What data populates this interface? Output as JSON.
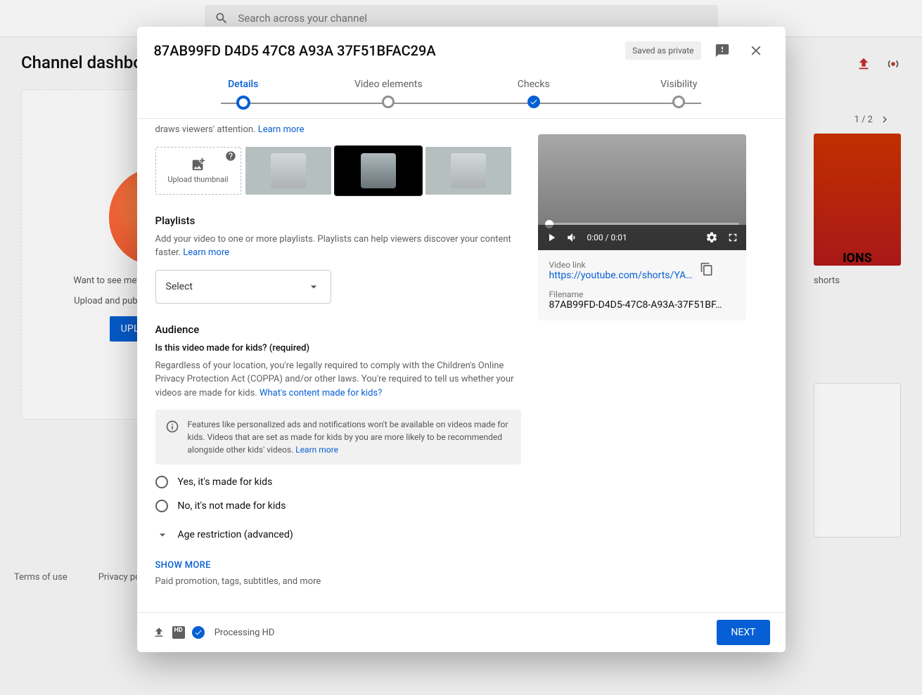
{
  "search": {
    "placeholder": "Search across your channel"
  },
  "page": {
    "title": "Channel dashboard",
    "left_card": {
      "prompt1": "Want to see metrics on your recent video?",
      "prompt2": "Upload and publish a video to get started.",
      "upload_btn": "UPLOAD VIDEOS"
    },
    "pager": "1 / 2",
    "news_thumb_text": "IONS",
    "news_caption": "shorts",
    "footer": {
      "terms": "Terms of use",
      "privacy": "Privacy policy"
    }
  },
  "modal": {
    "title": "87AB99FD D4D5 47C8 A93A 37F51BFAC29A",
    "saved_badge": "Saved as private",
    "steps": {
      "details": "Details",
      "elements": "Video elements",
      "checks": "Checks",
      "visibility": "Visibility"
    },
    "thumbs": {
      "hint_tail": "draws viewers' attention. ",
      "learn": "Learn more",
      "upload_label": "Upload thumbnail"
    },
    "playlists": {
      "heading": "Playlists",
      "sub": "Add your video to one or more playlists. Playlists can help viewers discover your content faster. ",
      "learn": "Learn more",
      "select": "Select"
    },
    "audience": {
      "heading": "Audience",
      "req": "Is this video made for kids? (required)",
      "coppa": "Regardless of your location, you're legally required to comply with the Children's Online Privacy Protection Act (COPPA) and/or other laws. You're required to tell us whether your videos are made for kids. ",
      "coppa_link": "What's content made for kids?",
      "info": "Features like personalized ads and notifications won't be available on videos made for kids. Videos that are set as made for kids by you are more likely to be recommended alongside other kids' videos. ",
      "info_link": "Learn more",
      "yes": "Yes, it's made for kids",
      "no": "No, it's not made for kids",
      "age": "Age restriction (advanced)"
    },
    "show_more": {
      "label": "SHOW MORE",
      "sub": "Paid promotion, tags, subtitles, and more"
    },
    "preview": {
      "time": "0:00 / 0:01",
      "vlink_label": "Video link",
      "vlink": "https://youtube.com/shorts/YA…",
      "fname_label": "Filename",
      "fname": "87AB99FD-D4D5-47C8-A93A-37F51BF…"
    },
    "footer": {
      "status": "Processing HD",
      "hd": "HD",
      "next": "NEXT"
    }
  }
}
